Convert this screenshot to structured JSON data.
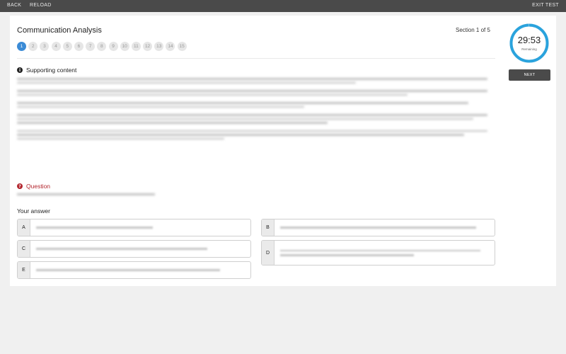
{
  "topbar": {
    "back": "BACK",
    "reload": "RELOAD",
    "exit": "EXIT TEST"
  },
  "page": {
    "title": "Communication Analysis",
    "section": "Section 1 of 5",
    "question_numbers": [
      "1",
      "2",
      "3",
      "4",
      "5",
      "6",
      "7",
      "8",
      "9",
      "10",
      "11",
      "12",
      "13",
      "14",
      "15"
    ],
    "active_question": 1
  },
  "support": {
    "heading": "Supporting content",
    "icon": "info-icon"
  },
  "question": {
    "heading": "Question",
    "icon": "question-icon"
  },
  "answers": {
    "heading": "Your answer",
    "options": [
      {
        "letter": "A"
      },
      {
        "letter": "B"
      },
      {
        "letter": "C"
      },
      {
        "letter": "D"
      },
      {
        "letter": "E"
      }
    ]
  },
  "timer": {
    "time": "29:53",
    "label": "Remaining",
    "color": "#2aa3dd",
    "progress": 0.996
  },
  "next": {
    "label": "NEXT"
  }
}
